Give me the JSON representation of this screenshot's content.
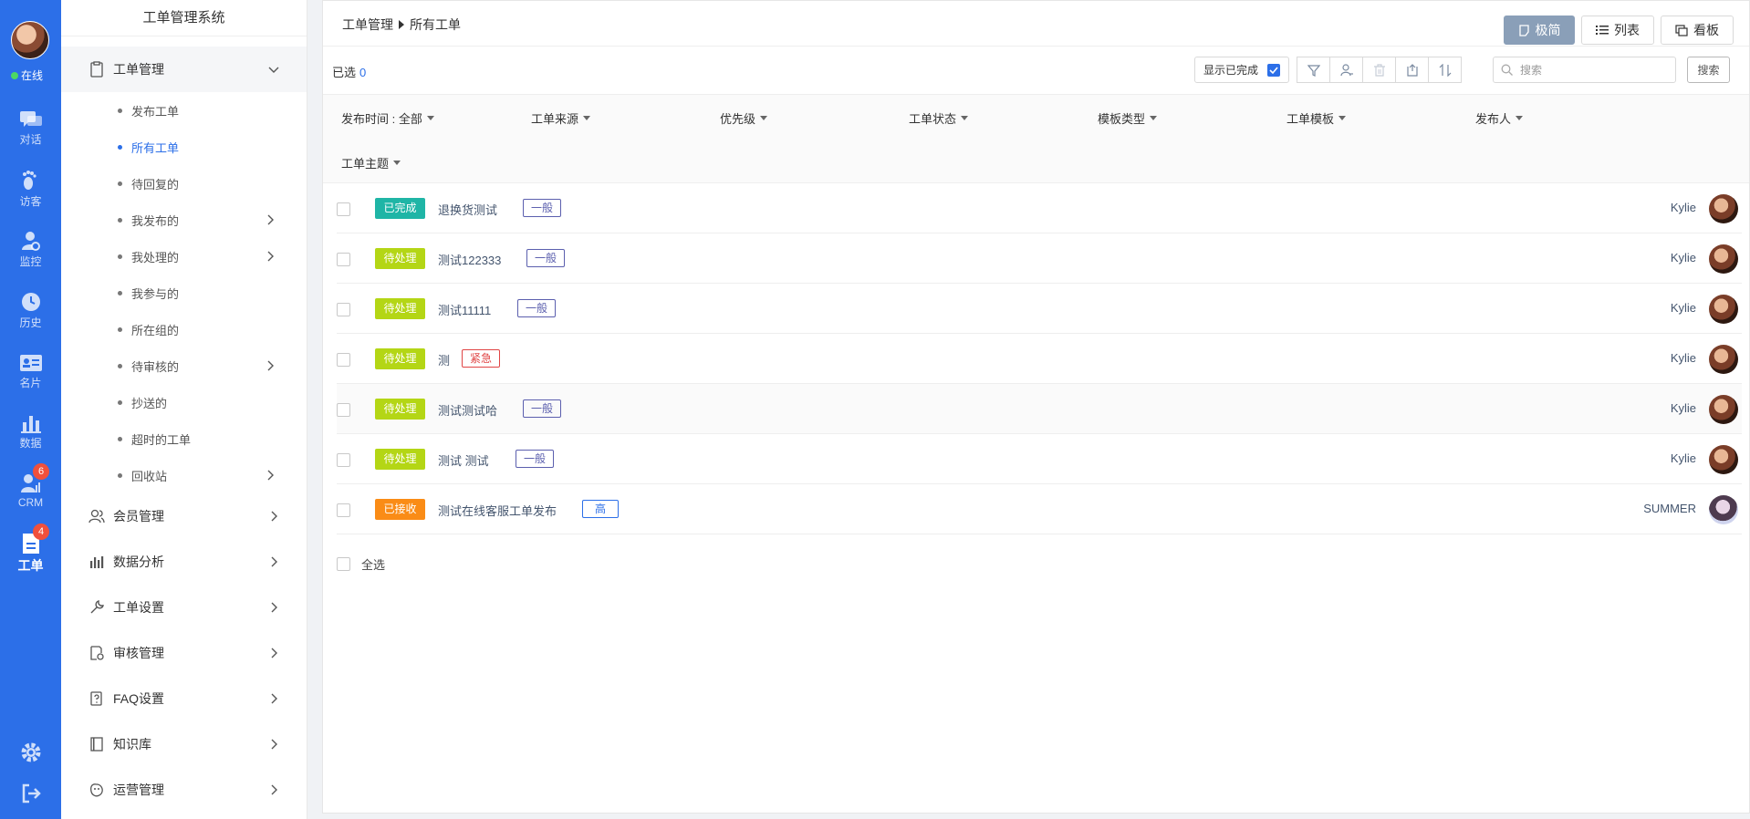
{
  "rail": {
    "status": "在线",
    "items": [
      {
        "label": "对话",
        "icon": "chat-icon"
      },
      {
        "label": "访客",
        "icon": "footprint-icon"
      },
      {
        "label": "监控",
        "icon": "monitor-user-icon"
      },
      {
        "label": "历史",
        "icon": "clock-icon"
      },
      {
        "label": "名片",
        "icon": "id-card-icon"
      },
      {
        "label": "数据",
        "icon": "bar-chart-icon"
      },
      {
        "label": "CRM",
        "icon": "crm-user-icon",
        "badge": "6"
      },
      {
        "label": "工单",
        "icon": "document-icon",
        "badge": "4"
      }
    ]
  },
  "menu": {
    "title": "工单管理系统",
    "groups": [
      {
        "label": "工单管理",
        "icon": "clipboard-icon"
      },
      {
        "label": "会员管理",
        "icon": "members-icon"
      },
      {
        "label": "数据分析",
        "icon": "analytics-icon"
      },
      {
        "label": "工单设置",
        "icon": "wrench-icon"
      },
      {
        "label": "审核管理",
        "icon": "audit-icon"
      },
      {
        "label": "FAQ设置",
        "icon": "faq-icon"
      },
      {
        "label": "知识库",
        "icon": "book-icon"
      },
      {
        "label": "运营管理",
        "icon": "operations-icon"
      }
    ],
    "subitems": [
      {
        "label": "发布工单"
      },
      {
        "label": "所有工单"
      },
      {
        "label": "待回复的"
      },
      {
        "label": "我发布的"
      },
      {
        "label": "我处理的"
      },
      {
        "label": "我参与的"
      },
      {
        "label": "所在组的"
      },
      {
        "label": "待审核的"
      },
      {
        "label": "抄送的"
      },
      {
        "label": "超时的工单"
      },
      {
        "label": "回收站"
      }
    ]
  },
  "breadcrumb": {
    "root": "工单管理",
    "current": "所有工单"
  },
  "views": {
    "simple": "极简",
    "list": "列表",
    "board": "看板"
  },
  "toolbar": {
    "selected_label": "已选",
    "selected_count": "0",
    "show_done": "显示已完成",
    "search_placeholder": "搜索",
    "search_button": "搜索"
  },
  "filters": [
    "发布时间 : 全部",
    "工单来源",
    "优先级",
    "工单状态",
    "模板类型",
    "工单模板",
    "发布人",
    "工单主题"
  ],
  "colors": {
    "accent": "#2c6fe8",
    "status_done": "#1fb5a6",
    "status_pending": "#b4d615",
    "status_received": "#fa8c16",
    "priority_normal": "#5b5fae",
    "priority_urgent": "#e04545",
    "priority_high": "#2c6fe8"
  },
  "tickets": [
    {
      "status": "已完成",
      "subject": "退换货测试",
      "priority": "一般",
      "publisher": "Kylie"
    },
    {
      "status": "待处理",
      "subject": "测试122333",
      "priority": "一般",
      "publisher": "Kylie"
    },
    {
      "status": "待处理",
      "subject": "测试11111",
      "priority": "一般",
      "publisher": "Kylie"
    },
    {
      "status": "待处理",
      "subject": "测",
      "priority": "紧急",
      "publisher": "Kylie"
    },
    {
      "status": "待处理",
      "subject": "测试测试哈",
      "priority": "一般",
      "publisher": "Kylie"
    },
    {
      "status": "待处理",
      "subject": "测试 测试",
      "priority": "一般",
      "publisher": "Kylie"
    },
    {
      "status": "已接收",
      "subject": "测试在线客服工单发布",
      "priority": "高",
      "publisher": "SUMMER"
    }
  ],
  "select_all": "全选"
}
